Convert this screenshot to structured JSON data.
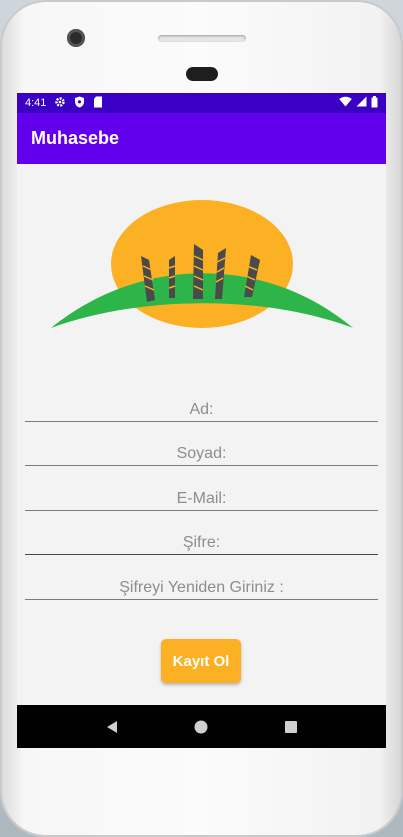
{
  "status_bar": {
    "time": "4:41",
    "left_icons": [
      "gear-icon",
      "shield-icon",
      "sd-card-icon"
    ],
    "right_icons": [
      "wifi-icon",
      "signal-icon",
      "battery-icon"
    ]
  },
  "app_bar": {
    "title": "Muhasebe"
  },
  "logo": {
    "icon": "sunrise-wheat-logo",
    "colors": {
      "sun": "#fbb123",
      "hill": "#2db54a",
      "stalks": "#4a4a4a"
    }
  },
  "form": {
    "fields": [
      {
        "name": "first-name",
        "placeholder": "Ad:",
        "value": ""
      },
      {
        "name": "last-name",
        "placeholder": "Soyad:",
        "value": ""
      },
      {
        "name": "email",
        "placeholder": "E-Mail:",
        "value": ""
      },
      {
        "name": "password",
        "placeholder": "Şifre:",
        "value": ""
      },
      {
        "name": "password-confirm",
        "placeholder": "Şifreyi Yeniden Giriniz :",
        "value": ""
      }
    ]
  },
  "register_button": {
    "label": "Kayıt Ol",
    "color": "#fbb123"
  },
  "nav_bar": {
    "buttons": [
      "back-icon",
      "home-icon",
      "recents-icon"
    ]
  },
  "colors": {
    "status_bar": "#3a00c4",
    "app_bar": "#6200ee",
    "background": "#f3f3f4"
  }
}
